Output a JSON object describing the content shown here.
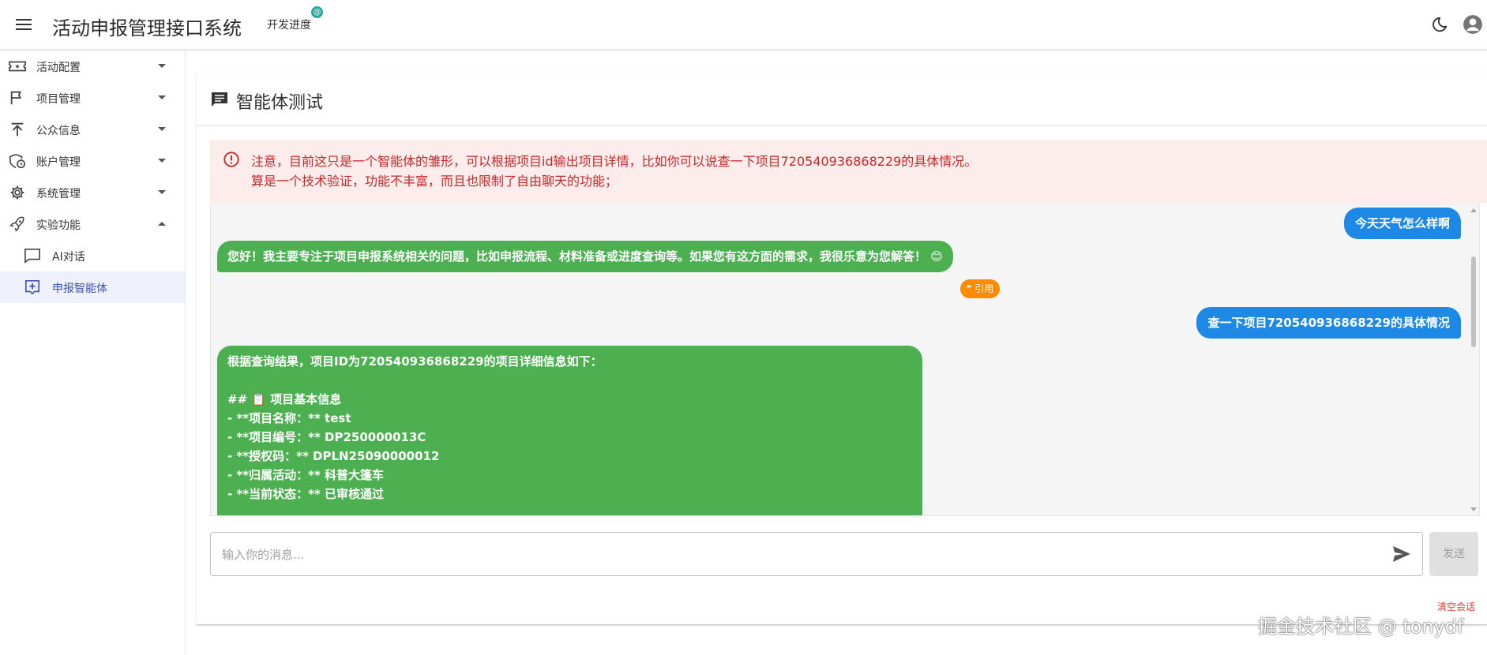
{
  "header": {
    "app_title": "活动申报管理接口系统",
    "dev_progress": "开发进度",
    "dev_badge": "@"
  },
  "sidebar": {
    "items": [
      {
        "label": "活动配置"
      },
      {
        "label": "项目管理"
      },
      {
        "label": "公众信息"
      },
      {
        "label": "账户管理"
      },
      {
        "label": "系统管理"
      },
      {
        "label": "实验功能"
      }
    ],
    "sub_items": [
      {
        "label": "AI对话"
      },
      {
        "label": "申报智能体"
      }
    ]
  },
  "main": {
    "title": "智能体测试",
    "notice": {
      "line1": "注意，目前这只是一个智能体的雏形，可以根据项目id输出项目详情，比如你可以说查一下项目720540936868229的具体情况。",
      "line2": "算是一个技术验证，功能不丰富，而且也限制了自由聊天的功能；"
    },
    "messages": {
      "user1": "今天天气怎么样啊",
      "bot1": "您好！我主要专注于项目申报系统相关的问题，比如申报流程、材料准备或进度查询等。如果您有这方面的需求，我很乐意为您解答！ 😊",
      "quote": "❞ 引用",
      "user2": "查一下项目720540936868229的具体情况",
      "bot2_lines": [
        "根据查询结果，项目ID为720540936868229的项目详细信息如下：",
        "",
        "## 📋 项目基本信息",
        "- **项目名称：** test",
        "- **项目编号：** DP250000013C",
        "- **授权码：** DPLN25090000012",
        "- **归属活动：** 科普大篷车",
        "- **当前状态：** 已审核通过"
      ]
    },
    "input_placeholder": "输入你的消息...",
    "send_label": "发送",
    "clear_label": "清空会话"
  },
  "watermark": "掘金技术社区 @ tonydf",
  "colors": {
    "user_bubble": "#1e88e5",
    "bot_bubble": "#4caf50",
    "notice_bg": "#fdecec",
    "notice_text": "#c62828",
    "active_nav": "#3f51b5"
  }
}
